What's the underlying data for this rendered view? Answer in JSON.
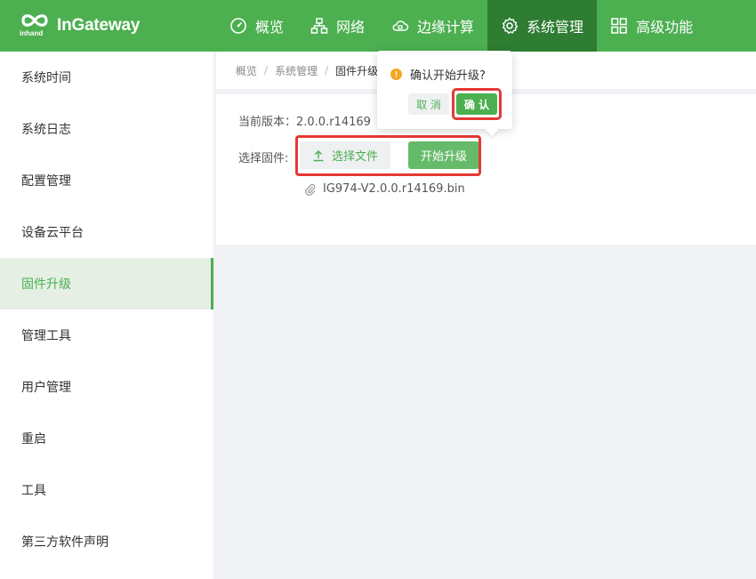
{
  "brand": {
    "logo_sub": "inhand",
    "name": "InGateway"
  },
  "nav": {
    "items": [
      {
        "label": "概览",
        "icon": "dashboard-icon"
      },
      {
        "label": "网络",
        "icon": "network-icon"
      },
      {
        "label": "边缘计算",
        "icon": "cloud-icon"
      },
      {
        "label": "系统管理",
        "icon": "gear-icon",
        "active": true
      },
      {
        "label": "高级功能",
        "icon": "grid-icon"
      }
    ]
  },
  "sidebar": {
    "items": [
      {
        "label": "系统时间"
      },
      {
        "label": "系统日志"
      },
      {
        "label": "配置管理"
      },
      {
        "label": "设备云平台"
      },
      {
        "label": "固件升级",
        "active": true
      },
      {
        "label": "管理工具"
      },
      {
        "label": "用户管理"
      },
      {
        "label": "重启"
      },
      {
        "label": "工具"
      },
      {
        "label": "第三方软件声明"
      }
    ]
  },
  "breadcrumb": {
    "items": [
      "概览",
      "系统管理",
      "固件升级"
    ],
    "separator": "/"
  },
  "firmware": {
    "version_label": "当前版本：2.0.0.r14169",
    "select_label": "选择固件:",
    "choose_file_label": "选择文件",
    "start_upgrade_label": "开始升级",
    "file_name": "IG974-V2.0.0.r14169.bin"
  },
  "popconfirm": {
    "message": "确认开始升级?",
    "cancel_label": "取 消",
    "confirm_label": "确 认"
  },
  "colors": {
    "brand_green": "#4caf50",
    "nav_active": "#2e7d32",
    "highlight_red": "#e53935",
    "warning_orange": "#f5a623"
  }
}
